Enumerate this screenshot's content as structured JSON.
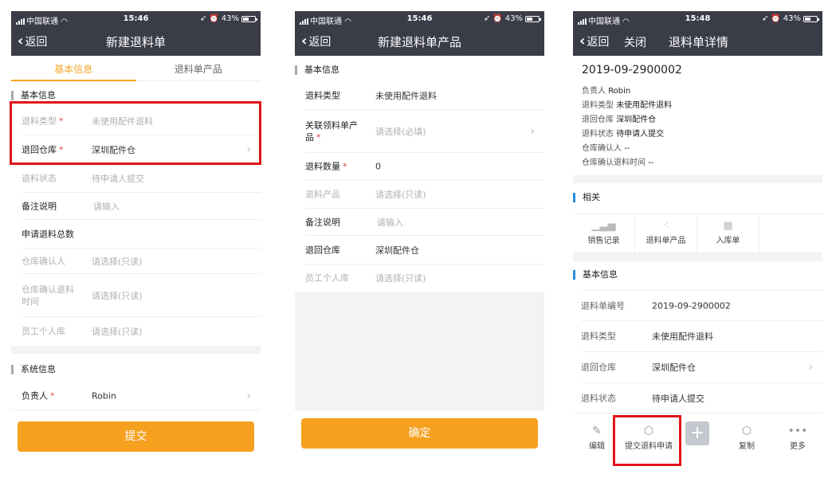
{
  "status": {
    "carrier": "中国联通",
    "battery": "43%",
    "time1": "15:46",
    "time2": "15:46",
    "time3": "15:48"
  },
  "p1": {
    "back": "返回",
    "title": "新建退料单",
    "tabs": [
      "基本信息",
      "退料单产品"
    ],
    "section_basic": "基本信息",
    "rows": [
      {
        "label": "退料类型",
        "value": "未使用配件退料"
      },
      {
        "label": "退回仓库",
        "value": "深圳配件仓"
      },
      {
        "label": "退料状态",
        "value": "待申请人提交"
      },
      {
        "label": "备注说明",
        "value": "请输入"
      },
      {
        "label": "申请退料总数",
        "value": ""
      },
      {
        "label": "仓库确认人",
        "value": "请选择(只读)"
      },
      {
        "label": "仓库确认退料时间",
        "value": "请选择(只读)"
      },
      {
        "label": "员工个人库",
        "value": "请选择(只读)"
      }
    ],
    "section_system": "系统信息",
    "owner_label": "负责人",
    "owner_value": "Robin",
    "required_mark": "*",
    "submit": "提交"
  },
  "p2": {
    "back": "返回",
    "title": "新建退料单产品",
    "section_basic": "基本信息",
    "rows": [
      {
        "label": "退料类型",
        "value": "未使用配件退料"
      },
      {
        "label": "关联领料单产品",
        "value": "请选择(必填)"
      },
      {
        "label": "退料数量",
        "value": "0"
      },
      {
        "label": "退料产品",
        "value": "请选择(只读)"
      },
      {
        "label": "备注说明",
        "value": "请输入"
      },
      {
        "label": "退回仓库",
        "value": "深圳配件仓"
      },
      {
        "label": "员工个人库",
        "value": "请选择(只读)"
      }
    ],
    "required_mark": "*",
    "confirm": "确定"
  },
  "p3": {
    "back": "返回",
    "close": "关闭",
    "title": "退料单详情",
    "doc_id": "2019-09-2900002",
    "summary": [
      {
        "k": "负责人",
        "v": "Robin"
      },
      {
        "k": "退料类型",
        "v": "未使用配件退料"
      },
      {
        "k": "退回仓库",
        "v": "深圳配件仓"
      },
      {
        "k": "退料状态",
        "v": "待申请人提交"
      },
      {
        "k": "仓库确认人",
        "v": "--"
      },
      {
        "k": "仓库确认退料时间",
        "v": "--"
      }
    ],
    "section_related": "相关",
    "related": [
      "销售记录",
      "退料单产品",
      "入库单"
    ],
    "section_basic": "基本信息",
    "rows": [
      {
        "label": "退料单编号",
        "value": "2019-09-2900002"
      },
      {
        "label": "退料类型",
        "value": "未使用配件退料"
      },
      {
        "label": "退回仓库",
        "value": "深圳配件仓"
      },
      {
        "label": "退料状态",
        "value": "待申请人提交"
      }
    ],
    "tools": {
      "edit": "编辑",
      "submit": "提交退料申请",
      "copy": "复制",
      "more": "更多"
    }
  },
  "colors": {
    "navbar": "#3a3c48",
    "accent": "#f5a01f",
    "highlight": "#e1131b",
    "section_blue": "#2a8bd6"
  }
}
